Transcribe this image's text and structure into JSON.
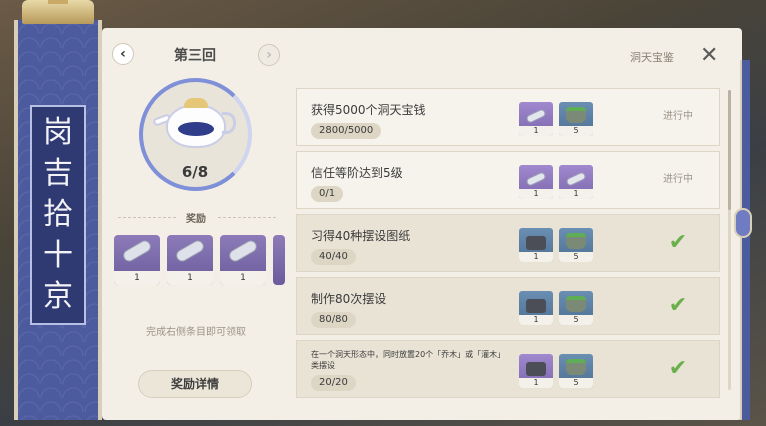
{
  "banner": {
    "chars": [
      "岗",
      "吉",
      "拾",
      "十",
      "京"
    ]
  },
  "header": {
    "prev_icon": "chevron-left-icon",
    "prev_glyph": "‹",
    "title": "第三回",
    "next_icon": "chevron-right-icon",
    "next_glyph": "›",
    "page_label": "洞天宝鉴",
    "close_glyph": "✕"
  },
  "teapot": {
    "progress_text": "6/8",
    "progress_value": 0.75
  },
  "rewards": {
    "label": "奖励",
    "items": [
      {
        "icon": "scroll-icon",
        "count": "1"
      },
      {
        "icon": "scroll-icon",
        "count": "1"
      },
      {
        "icon": "scroll-icon",
        "count": "1"
      }
    ],
    "hint": "完成右侧条目即可领取",
    "detail_button": "奖励详情"
  },
  "tasks": [
    {
      "title": "获得5000个洞天宝钱",
      "progress": "2800/5000",
      "items": [
        {
          "icon": "scroll-icon",
          "count": "1",
          "tone": "purple"
        },
        {
          "icon": "rock-icon",
          "count": "5",
          "tone": "blue"
        }
      ],
      "status": "进行中",
      "done": false
    },
    {
      "title": "信任等阶达到5级",
      "progress": "0/1",
      "items": [
        {
          "icon": "scroll-icon",
          "count": "1",
          "tone": "purple"
        },
        {
          "icon": "scroll-icon",
          "count": "1",
          "tone": "purple"
        }
      ],
      "status": "进行中",
      "done": false
    },
    {
      "title": "习得40种摆设图纸",
      "progress": "40/40",
      "items": [
        {
          "icon": "furniture-icon",
          "count": "1",
          "tone": "blue"
        },
        {
          "icon": "rock-icon",
          "count": "5",
          "tone": "blue"
        }
      ],
      "status": "✔",
      "done": true
    },
    {
      "title": "制作80次摆设",
      "progress": "80/80",
      "items": [
        {
          "icon": "furniture-icon",
          "count": "1",
          "tone": "blue"
        },
        {
          "icon": "rock-icon",
          "count": "5",
          "tone": "blue"
        }
      ],
      "status": "✔",
      "done": true
    },
    {
      "title": "在一个洞天形态中，同时放置20个「乔木」或「灌木」类摆设",
      "progress": "20/20",
      "items": [
        {
          "icon": "furniture-icon",
          "count": "1",
          "tone": "purple"
        },
        {
          "icon": "rock-icon",
          "count": "5",
          "tone": "blue"
        }
      ],
      "status": "✔",
      "done": true
    }
  ]
}
